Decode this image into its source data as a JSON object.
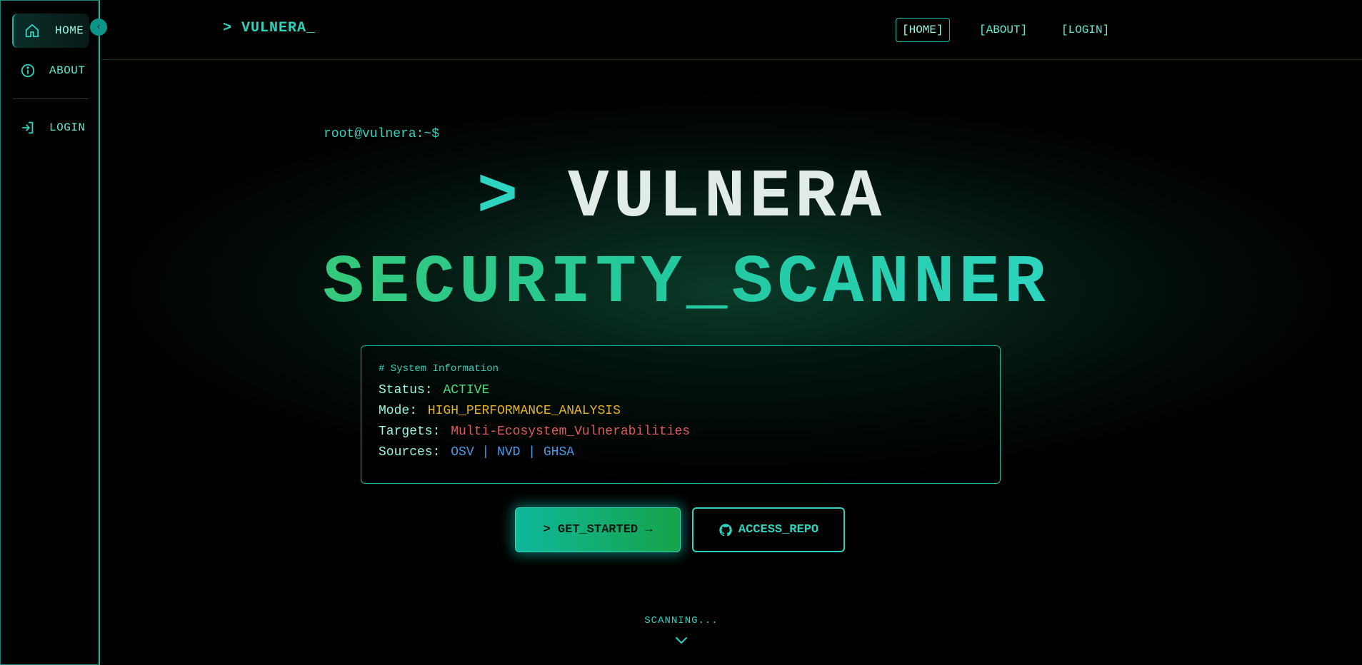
{
  "sidebar": {
    "items": [
      {
        "label": "HOME",
        "icon": "home-icon"
      },
      {
        "label": "ABOUT",
        "icon": "info-icon"
      },
      {
        "label": "LOGIN",
        "icon": "login-icon"
      }
    ],
    "collapse_glyph": "‹"
  },
  "nav": {
    "brand": "> VULNERA_",
    "links": [
      "[HOME]",
      "[ABOUT]",
      "[LOGIN]"
    ]
  },
  "hero": {
    "prompt": "root@vulnera:~$",
    "title_chevron": ">",
    "title_word": "VULNERA",
    "subtitle": "SECURITY_SCANNER"
  },
  "system_info": {
    "heading": "# System Information",
    "rows": [
      {
        "key": "Status:",
        "value": "ACTIVE"
      },
      {
        "key": "Mode:",
        "value": "HIGH_PERFORMANCE_ANALYSIS"
      },
      {
        "key": "Targets:",
        "value": "Multi-Ecosystem_Vulnerabilities"
      },
      {
        "key": "Sources:",
        "value": "OSV | NVD | GHSA"
      }
    ]
  },
  "actions": {
    "get_started": "> GET_STARTED →",
    "access_repo": "ACCESS_REPO"
  },
  "footer": {
    "scanning": "SCANNING..."
  },
  "colors": {
    "accent": "#2dd4bf",
    "status_active": "#4ade80",
    "mode": "#e6b422",
    "targets": "#e05a5a",
    "sources": "#4a9be8"
  }
}
